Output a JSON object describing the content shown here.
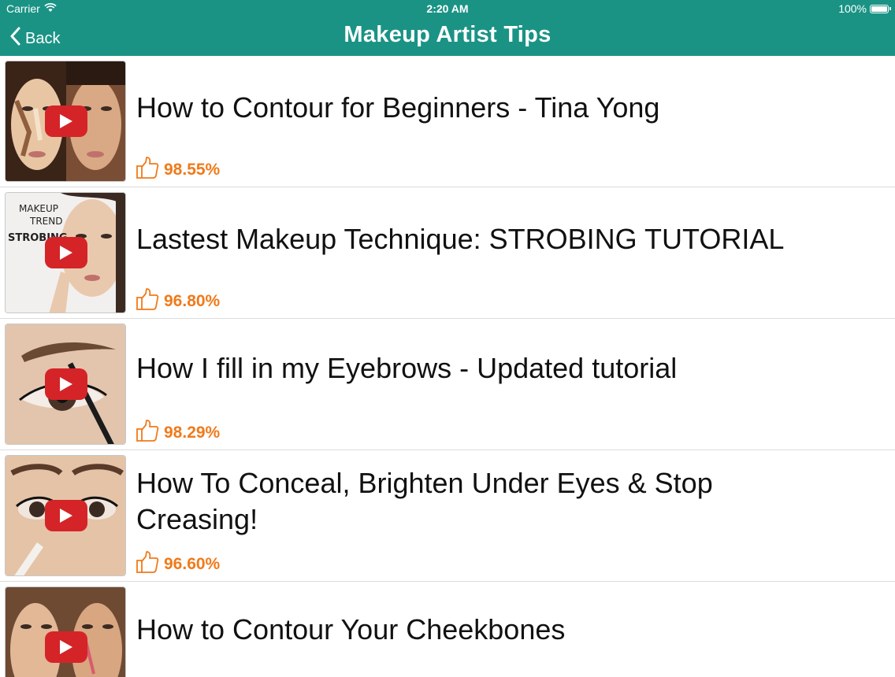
{
  "status": {
    "carrier": "Carrier",
    "time": "2:20 AM",
    "battery": "100%"
  },
  "nav": {
    "back_label": "Back",
    "title": "Makeup Artist Tips"
  },
  "colors": {
    "bar": "#1a9385",
    "rating": "#f07a1a",
    "play": "#d42428"
  },
  "videos": [
    {
      "title": "How to Contour for Beginners - Tina Yong",
      "rating": "98.55%"
    },
    {
      "title": "Lastest Makeup Technique:  STROBING TUTORIAL",
      "rating": "96.80%",
      "thumb_text": [
        "MAKEUP",
        "TREND",
        "STROBING"
      ]
    },
    {
      "title": "How I fill in my Eyebrows - Updated tutorial",
      "rating": "98.29%"
    },
    {
      "title": "How To Conceal, Brighten Under Eyes & Stop Creasing!",
      "rating": "96.60%"
    },
    {
      "title": "How to Contour Your Cheekbones",
      "rating": ""
    }
  ]
}
